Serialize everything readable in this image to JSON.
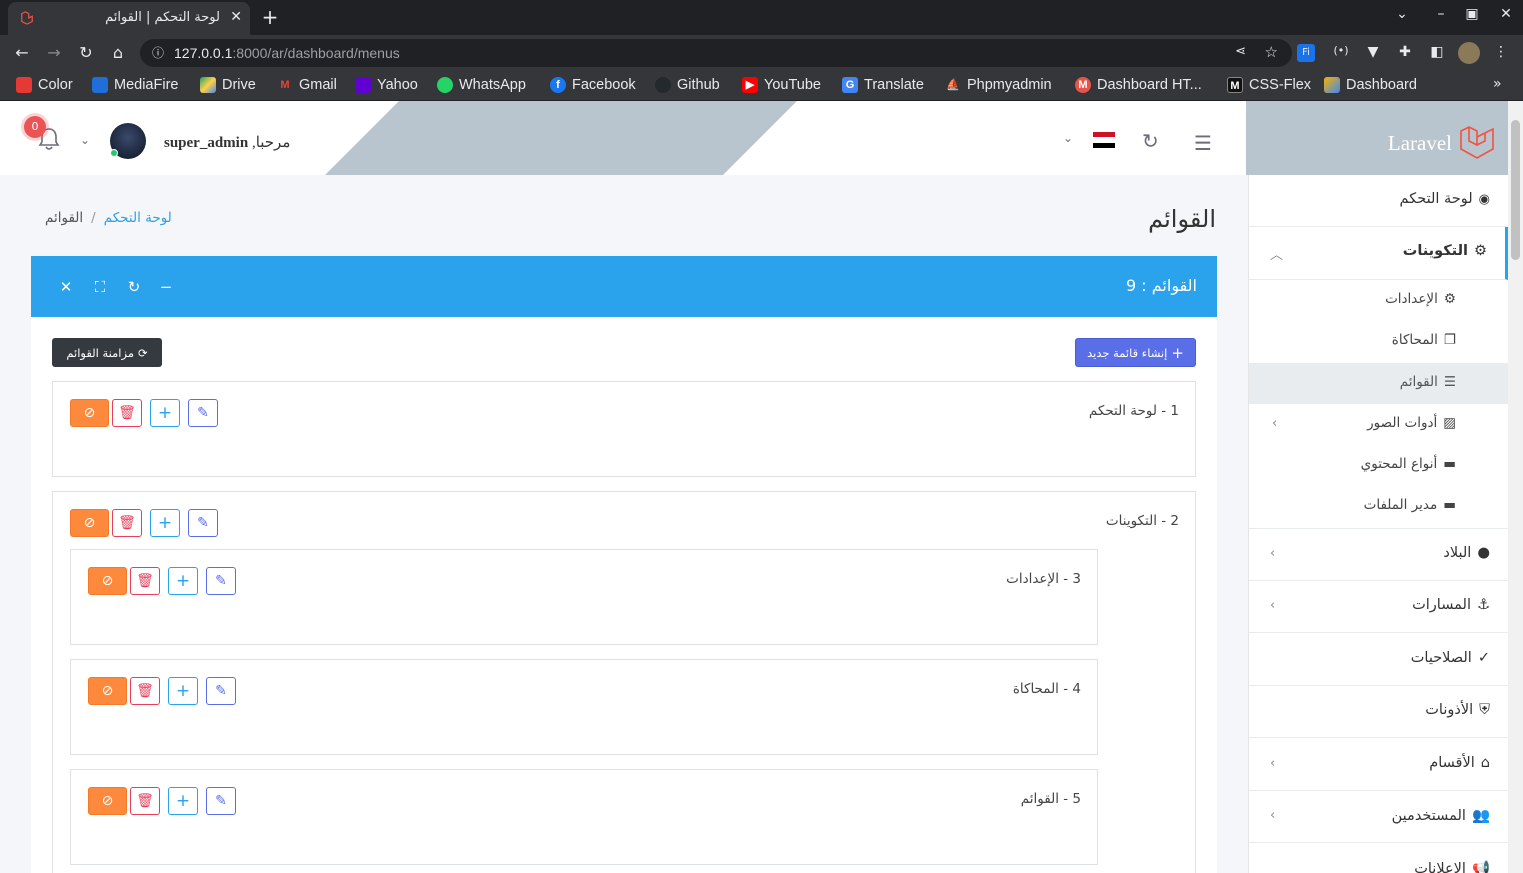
{
  "browser": {
    "tab_title": "لوحة التحكم | القوائم",
    "url_host": "127.0.0.1",
    "url_rest": ":8000/ar/dashboard/menus",
    "bookmarks": [
      "Color",
      "MediaFire",
      "Drive",
      "Gmail",
      "Yahoo",
      "WhatsApp",
      "Facebook",
      "Github",
      "YouTube",
      "Translate",
      "Phpmyadmin",
      "Dashboard HT...",
      "CSS-Flex",
      "Dashboard"
    ]
  },
  "header": {
    "brand": "Laravel",
    "greeting": "مرحبا,",
    "username": "super_admin",
    "notifications_count": "0"
  },
  "sidebar": {
    "dashboard": "لوحة التحكم",
    "configs": "التكوينات",
    "settings": "الإعدادات",
    "simulation": "المحاكاة",
    "menus": "القوائم",
    "image_tools": "أدوات الصور",
    "content_types": "أنواع المحتوي",
    "file_manager": "مدير الملفات",
    "countries": "البلاد",
    "routes": "المسارات",
    "permissions": "الصلاحيات",
    "abilities": "الأذونات",
    "sections": "الأقسام",
    "users": "المستخدمين",
    "ads": "الإعلانات"
  },
  "page": {
    "title": "القوائم",
    "breadcrumb_home": "لوحة التحكم",
    "breadcrumb_sep": "/",
    "breadcrumb_current": "القوائم",
    "card_title": "القوائم : 9",
    "create_button": "إنشاء قائمة جديد",
    "sync_button": "مزامنة القوائم"
  },
  "menus": [
    {
      "label": "1 - لوحة التحكم"
    },
    {
      "label": "2 - التكوينات"
    },
    {
      "label": "3 - الإعدادات"
    },
    {
      "label": "4 - المحاكاة"
    },
    {
      "label": "5 - القوائم"
    }
  ],
  "colors": {
    "primary": "#2aa2ec",
    "indigo": "#5a6ee8",
    "danger": "#e83e5a",
    "warning": "#fd8a3c",
    "dark": "#343a40",
    "brand_bg": "#b8c5cf"
  }
}
